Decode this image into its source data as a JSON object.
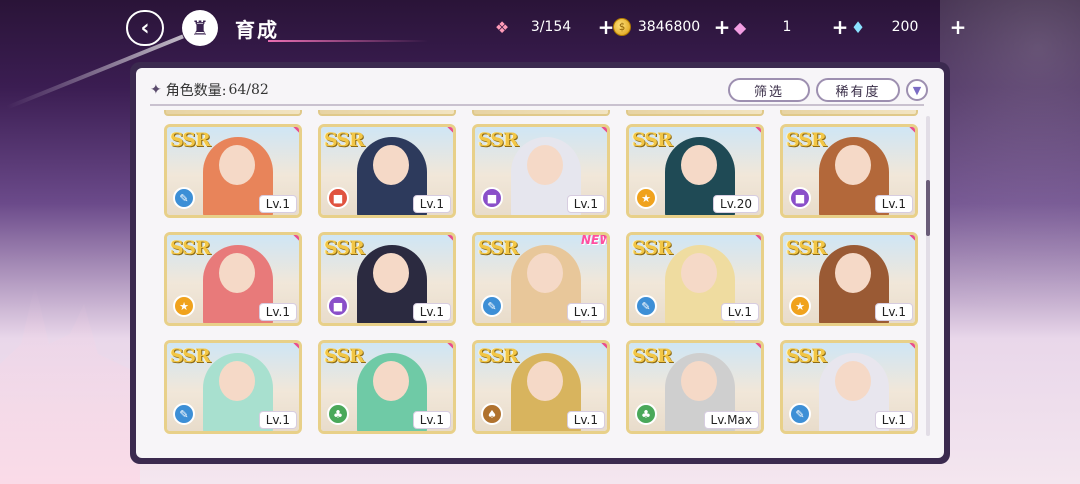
{
  "header": {
    "title": "育成",
    "back_icon": "back-arrow-icon",
    "home_icon": "castle-home-icon"
  },
  "resources": [
    {
      "icon": "candy-icon",
      "value": "3/154"
    },
    {
      "icon": "coin-icon",
      "value": "3846800"
    },
    {
      "icon": "pink-gem-icon",
      "value": "1"
    },
    {
      "icon": "blue-diamond-icon",
      "value": "200"
    }
  ],
  "panel": {
    "count_label": "角色数量:",
    "count_value": "64/82",
    "filter_label": "筛选",
    "rarity_label": "稀有度"
  },
  "colors": {
    "panel_frame": "#3b2a4f",
    "card_border": "#e8d089",
    "corner_mark": "#e94d8b"
  },
  "cards": [
    {
      "rarity": "SSR",
      "level": "Lv.1",
      "new": "",
      "attr": "blue",
      "hair": "#e8845a"
    },
    {
      "rarity": "SSR",
      "level": "Lv.1",
      "new": "",
      "attr": "red",
      "hair": "#2d3a5c"
    },
    {
      "rarity": "SSR",
      "level": "Lv.1",
      "new": "",
      "attr": "purple",
      "hair": "#e6e6ee"
    },
    {
      "rarity": "SSR",
      "level": "Lv.20",
      "new": "",
      "attr": "orange",
      "hair": "#1f4a55"
    },
    {
      "rarity": "SSR",
      "level": "Lv.1",
      "new": "",
      "attr": "purple",
      "hair": "#b3683a"
    },
    {
      "rarity": "SSR",
      "level": "Lv.1",
      "new": "",
      "attr": "orange",
      "hair": "#e87a7a"
    },
    {
      "rarity": "SSR",
      "level": "Lv.1",
      "new": "",
      "attr": "purple",
      "hair": "#2b2a40"
    },
    {
      "rarity": "SSR",
      "level": "Lv.1",
      "new": "NEW",
      "attr": "blue",
      "hair": "#e8c79a"
    },
    {
      "rarity": "SSR",
      "level": "Lv.1",
      "new": "",
      "attr": "blue",
      "hair": "#efdca0"
    },
    {
      "rarity": "SSR",
      "level": "Lv.1",
      "new": "",
      "attr": "orange",
      "hair": "#9a5a34"
    },
    {
      "rarity": "SSR",
      "level": "Lv.1",
      "new": "",
      "attr": "blue",
      "hair": "#a8e0cf"
    },
    {
      "rarity": "SSR",
      "level": "Lv.1",
      "new": "",
      "attr": "green",
      "hair": "#6fcaa6"
    },
    {
      "rarity": "SSR",
      "level": "Lv.1",
      "new": "",
      "attr": "brown",
      "hair": "#d8b45e"
    },
    {
      "rarity": "SSR",
      "level": "Lv.Max",
      "new": "",
      "attr": "green",
      "hair": "#cfcfcf"
    },
    {
      "rarity": "SSR",
      "level": "Lv.1",
      "new": "",
      "attr": "blue",
      "hair": "#e8e6ee"
    }
  ]
}
